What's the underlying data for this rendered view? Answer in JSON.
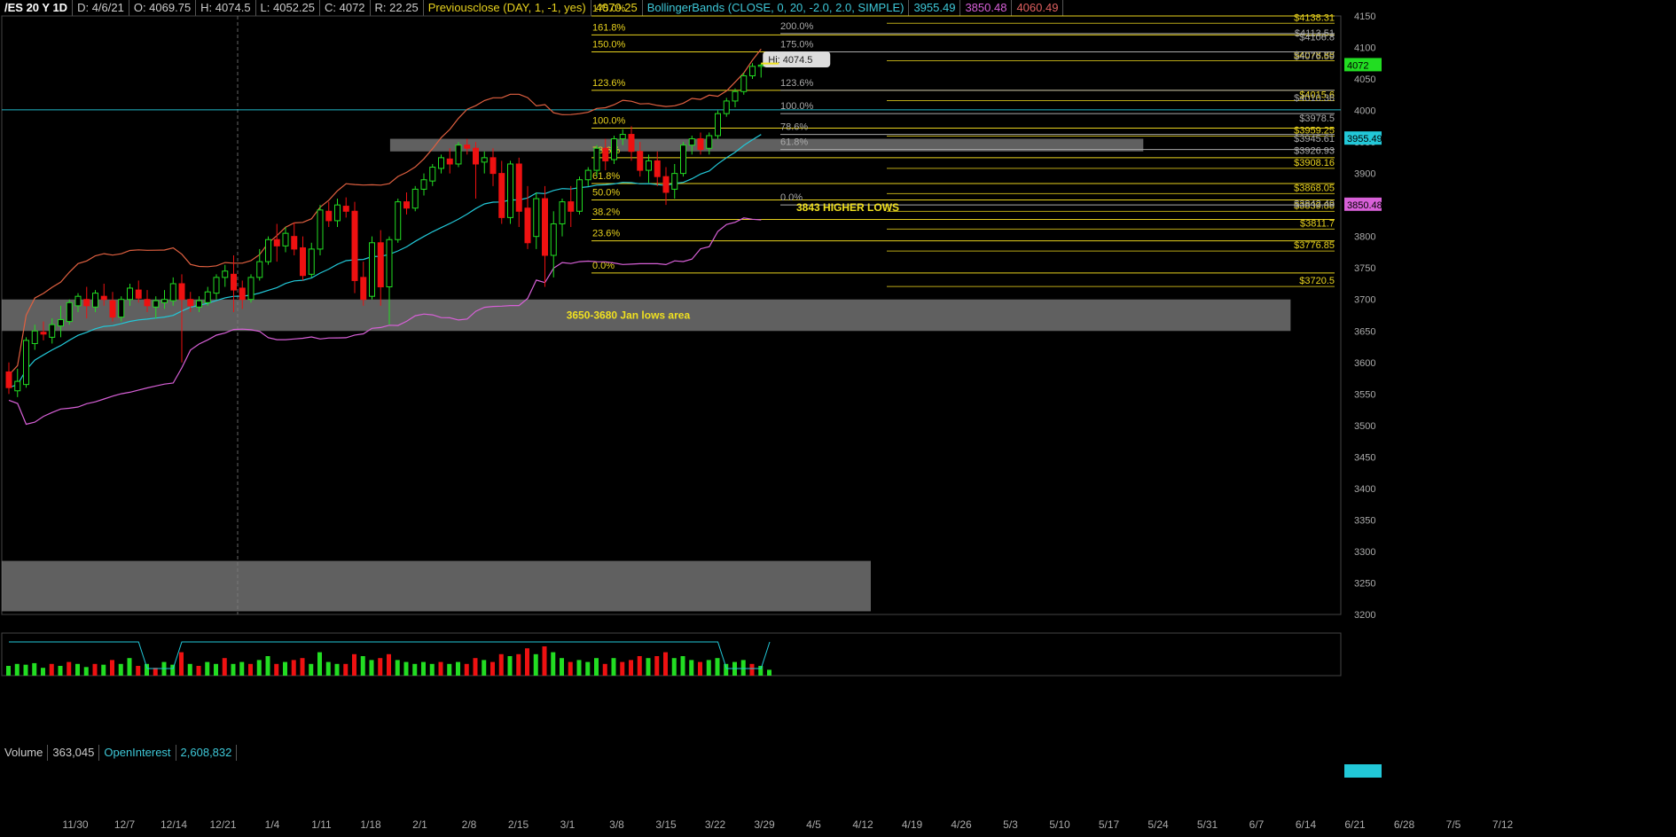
{
  "header": {
    "symbol": "/ES 20 Y 1D",
    "date": "D: 4/6/21",
    "open": "O: 4069.75",
    "high": "H: 4074.5",
    "low": "L: 4052.25",
    "close": "C: 4072",
    "range": "R: 22.25",
    "prevclose_label": "Previousclose (DAY, 1, -1, yes)",
    "prevclose_value": "4070.25",
    "bb_label": "BollingerBands (CLOSE, 0, 20, -2.0, 2.0, SIMPLE)",
    "bb_mid": "3955.49",
    "bb_lower": "3850.48",
    "bb_upper": "4060.49"
  },
  "volume_header": {
    "volume_label": "Volume",
    "volume_value": "363,045",
    "oi_label": "OpenInterest",
    "oi_value": "2,608,832"
  },
  "colors": {
    "up": "#22dd22",
    "down": "#ee1111",
    "fib": "#e8d21e",
    "bb_mid": "#22c8d8",
    "bb_upper": "#e06040",
    "bb_lower": "#d860d8",
    "zone": "#808080",
    "gray_line": "#aaaaaa"
  },
  "chart_data": {
    "type": "candlestick",
    "ylim": [
      3200,
      4150
    ],
    "y_ticks": [
      3200,
      3250,
      3300,
      3350,
      3400,
      3450,
      3500,
      3550,
      3600,
      3650,
      3700,
      3750,
      3800,
      3850,
      3900,
      3950,
      4000,
      4050,
      4100,
      4150
    ],
    "x_tick_labels": [
      "11/30",
      "12/7",
      "12/14",
      "12/21",
      "1/4",
      "1/11",
      "1/18",
      "2/1",
      "2/8",
      "2/15",
      "3/1",
      "3/8",
      "3/15",
      "3/22",
      "3/29",
      "4/5",
      "4/12",
      "4/19",
      "4/26",
      "5/3",
      "5/10",
      "5/17",
      "5/24",
      "5/31",
      "6/7",
      "6/14",
      "6/21",
      "6/28",
      "7/5",
      "7/12"
    ],
    "last_price": "4072",
    "bb_mid_tag": "3955.49",
    "bb_lower_tag": "3850.48",
    "hi_label": "Hi: 4074.5",
    "candles": [
      [
        3585,
        3600,
        3560,
        3550
      ],
      [
        3555,
        3590,
        3570,
        3545
      ],
      [
        3565,
        3640,
        3635,
        3560
      ],
      [
        3630,
        3660,
        3650,
        3620
      ],
      [
        3648,
        3665,
        3645,
        3635
      ],
      [
        3640,
        3670,
        3660,
        3630
      ],
      [
        3658,
        3690,
        3668,
        3640
      ],
      [
        3665,
        3700,
        3695,
        3660
      ],
      [
        3690,
        3710,
        3705,
        3680
      ],
      [
        3700,
        3720,
        3690,
        3670
      ],
      [
        3688,
        3715,
        3710,
        3680
      ],
      [
        3705,
        3725,
        3700,
        3690
      ],
      [
        3698,
        3712,
        3672,
        3665
      ],
      [
        3672,
        3705,
        3700,
        3665
      ],
      [
        3700,
        3725,
        3718,
        3690
      ],
      [
        3715,
        3730,
        3702,
        3695
      ],
      [
        3700,
        3715,
        3690,
        3680
      ],
      [
        3688,
        3705,
        3698,
        3670
      ],
      [
        3695,
        3715,
        3700,
        3685
      ],
      [
        3698,
        3735,
        3725,
        3690
      ],
      [
        3725,
        3740,
        3700,
        3600
      ],
      [
        3700,
        3712,
        3690,
        3680
      ],
      [
        3688,
        3705,
        3698,
        3680
      ],
      [
        3695,
        3720,
        3712,
        3690
      ],
      [
        3710,
        3740,
        3735,
        3700
      ],
      [
        3735,
        3755,
        3745,
        3720
      ],
      [
        3740,
        3770,
        3715,
        3680
      ],
      [
        3718,
        3730,
        3700,
        3685
      ],
      [
        3700,
        3740,
        3735,
        3695
      ],
      [
        3735,
        3780,
        3760,
        3730
      ],
      [
        3760,
        3800,
        3795,
        3755
      ],
      [
        3795,
        3820,
        3785,
        3760
      ],
      [
        3785,
        3815,
        3805,
        3775
      ],
      [
        3800,
        3822,
        3780,
        3770
      ],
      [
        3782,
        3800,
        3738,
        3730
      ],
      [
        3740,
        3790,
        3780,
        3735
      ],
      [
        3780,
        3850,
        3842,
        3770
      ],
      [
        3840,
        3855,
        3825,
        3815
      ],
      [
        3825,
        3860,
        3850,
        3815
      ],
      [
        3848,
        3862,
        3840,
        3830
      ],
      [
        3840,
        3855,
        3730,
        3710
      ],
      [
        3735,
        3760,
        3700,
        3690
      ],
      [
        3705,
        3800,
        3790,
        3700
      ],
      [
        3790,
        3810,
        3720,
        3690
      ],
      [
        3720,
        3800,
        3795,
        3660
      ],
      [
        3795,
        3860,
        3855,
        3790
      ],
      [
        3855,
        3870,
        3845,
        3835
      ],
      [
        3845,
        3880,
        3875,
        3840
      ],
      [
        3875,
        3900,
        3890,
        3865
      ],
      [
        3888,
        3915,
        3910,
        3880
      ],
      [
        3908,
        3930,
        3925,
        3900
      ],
      [
        3923,
        3940,
        3915,
        3900
      ],
      [
        3915,
        3950,
        3945,
        3910
      ],
      [
        3945,
        3955,
        3940,
        3930
      ],
      [
        3940,
        3950,
        3915,
        3860
      ],
      [
        3918,
        3935,
        3925,
        3900
      ],
      [
        3925,
        3940,
        3900,
        3880
      ],
      [
        3900,
        3920,
        3830,
        3820
      ],
      [
        3830,
        3920,
        3915,
        3820
      ],
      [
        3915,
        3925,
        3840,
        3815
      ],
      [
        3845,
        3880,
        3790,
        3780
      ],
      [
        3800,
        3870,
        3860,
        3780
      ],
      [
        3860,
        3880,
        3770,
        3720
      ],
      [
        3770,
        3840,
        3820,
        3735
      ],
      [
        3820,
        3860,
        3855,
        3800
      ],
      [
        3855,
        3880,
        3840,
        3815
      ],
      [
        3840,
        3895,
        3890,
        3835
      ],
      [
        3890,
        3910,
        3905,
        3880
      ],
      [
        3905,
        3945,
        3940,
        3895
      ],
      [
        3940,
        3955,
        3920,
        3905
      ],
      [
        3922,
        3960,
        3955,
        3915
      ],
      [
        3955,
        3970,
        3962,
        3945
      ],
      [
        3962,
        3975,
        3935,
        3920
      ],
      [
        3935,
        3950,
        3905,
        3895
      ],
      [
        3905,
        3930,
        3920,
        3885
      ],
      [
        3920,
        3935,
        3895,
        3880
      ],
      [
        3895,
        3910,
        3870,
        3850
      ],
      [
        3875,
        3915,
        3900,
        3860
      ],
      [
        3900,
        3950,
        3945,
        3895
      ],
      [
        3945,
        3960,
        3955,
        3930
      ],
      [
        3955,
        3965,
        3938,
        3930
      ],
      [
        3940,
        3965,
        3960,
        3930
      ],
      [
        3960,
        4000,
        3995,
        3955
      ],
      [
        3995,
        4020,
        4015,
        3990
      ],
      [
        4015,
        4035,
        4030,
        4005
      ],
      [
        4030,
        4060,
        4055,
        4025
      ],
      [
        4055,
        4075,
        4070,
        4050
      ],
      [
        4070,
        4074.5,
        4072,
        4052.25
      ]
    ],
    "volume": [
      [
        0.25,
        1
      ],
      [
        0.3,
        1
      ],
      [
        0.28,
        1
      ],
      [
        0.32,
        1
      ],
      [
        0.2,
        1
      ],
      [
        0.3,
        0
      ],
      [
        0.25,
        1
      ],
      [
        0.35,
        0
      ],
      [
        0.3,
        1
      ],
      [
        0.22,
        1
      ],
      [
        0.3,
        0
      ],
      [
        0.28,
        1
      ],
      [
        0.4,
        0
      ],
      [
        0.3,
        1
      ],
      [
        0.45,
        1
      ],
      [
        0.25,
        0
      ],
      [
        0.3,
        1
      ],
      [
        0.2,
        0
      ],
      [
        0.35,
        1
      ],
      [
        0.28,
        1
      ],
      [
        0.6,
        0
      ],
      [
        0.3,
        1
      ],
      [
        0.25,
        0
      ],
      [
        0.35,
        1
      ],
      [
        0.3,
        1
      ],
      [
        0.45,
        0
      ],
      [
        0.3,
        1
      ],
      [
        0.35,
        1
      ],
      [
        0.3,
        0
      ],
      [
        0.4,
        1
      ],
      [
        0.5,
        1
      ],
      [
        0.3,
        0
      ],
      [
        0.35,
        1
      ],
      [
        0.4,
        0
      ],
      [
        0.45,
        0
      ],
      [
        0.3,
        1
      ],
      [
        0.6,
        1
      ],
      [
        0.35,
        1
      ],
      [
        0.3,
        1
      ],
      [
        0.3,
        0
      ],
      [
        0.55,
        0
      ],
      [
        0.5,
        1
      ],
      [
        0.4,
        1
      ],
      [
        0.45,
        0
      ],
      [
        0.55,
        0
      ],
      [
        0.4,
        1
      ],
      [
        0.35,
        1
      ],
      [
        0.3,
        1
      ],
      [
        0.35,
        1
      ],
      [
        0.3,
        1
      ],
      [
        0.35,
        0
      ],
      [
        0.3,
        1
      ],
      [
        0.35,
        1
      ],
      [
        0.3,
        0
      ],
      [
        0.45,
        0
      ],
      [
        0.4,
        1
      ],
      [
        0.35,
        0
      ],
      [
        0.55,
        0
      ],
      [
        0.5,
        1
      ],
      [
        0.55,
        0
      ],
      [
        0.7,
        0
      ],
      [
        0.55,
        1
      ],
      [
        0.75,
        0
      ],
      [
        0.6,
        1
      ],
      [
        0.45,
        1
      ],
      [
        0.35,
        0
      ],
      [
        0.4,
        1
      ],
      [
        0.35,
        1
      ],
      [
        0.45,
        1
      ],
      [
        0.3,
        0
      ],
      [
        0.45,
        1
      ],
      [
        0.35,
        0
      ],
      [
        0.4,
        0
      ],
      [
        0.5,
        0
      ],
      [
        0.45,
        1
      ],
      [
        0.5,
        0
      ],
      [
        0.6,
        0
      ],
      [
        0.45,
        1
      ],
      [
        0.5,
        1
      ],
      [
        0.4,
        1
      ],
      [
        0.35,
        0
      ],
      [
        0.4,
        1
      ],
      [
        0.45,
        1
      ],
      [
        0.3,
        1
      ],
      [
        0.35,
        1
      ],
      [
        0.4,
        1
      ],
      [
        0.3,
        0
      ],
      [
        0.25,
        1
      ],
      [
        0.15,
        1
      ]
    ],
    "zones": [
      {
        "top": 3955,
        "bottom": 3935,
        "x_from": 0.29,
        "x_to": 0.775
      },
      {
        "top": 3700,
        "bottom": 3650,
        "x_from": 0.0,
        "x_to": 0.875,
        "label": "3650-3680 Jan lows area"
      },
      {
        "top": 3285,
        "bottom": 3205,
        "x_from": 0.0,
        "x_to": 0.59
      }
    ],
    "fib_left": {
      "levels": [
        {
          "pct": "175.0%",
          "price": 4150
        },
        {
          "pct": "161.8%",
          "price": 4120
        },
        {
          "pct": "150.0%",
          "price": 4093
        },
        {
          "pct": "123.6%",
          "price": 4032
        },
        {
          "pct": "100.0%",
          "price": 3972
        },
        {
          "pct": "78.6%",
          "price": 3925
        },
        {
          "pct": "61.8%",
          "price": 3884
        },
        {
          "pct": "50.0%",
          "price": 3858
        },
        {
          "pct": "38.2%",
          "price": 3827
        },
        {
          "pct": "23.6%",
          "price": 3793
        },
        {
          "pct": "0.0%",
          "price": 3742
        }
      ],
      "right_labels": [
        {
          "text": "$4138.31",
          "price": 4138.31
        },
        {
          "text": "$4078.88",
          "price": 4078.88
        },
        {
          "text": "$4015.6",
          "price": 4015.6
        },
        {
          "text": "$3959.25",
          "price": 3959.25
        },
        {
          "text": "$3908.16",
          "price": 3908.16
        },
        {
          "text": "$3868.05",
          "price": 3868.05
        },
        {
          "text": "$3839.88",
          "price": 3839.88
        },
        {
          "text": "$3811.7",
          "price": 3811.7
        },
        {
          "text": "$3776.85",
          "price": 3776.85
        },
        {
          "text": "$3720.5",
          "price": 3720.5
        }
      ]
    },
    "fib_right": {
      "levels": [
        {
          "pct": "200.0%",
          "price": 4122
        },
        {
          "pct": "175.0%",
          "price": 4093
        },
        {
          "pct": "123.6%",
          "price": 4032
        },
        {
          "pct": "100.0%",
          "price": 3995
        },
        {
          "pct": "78.6%",
          "price": 3962
        },
        {
          "pct": "61.8%",
          "price": 3938
        },
        {
          "pct": "0.0%",
          "price": 3850
        }
      ],
      "right_labels": [
        {
          "text": "$4113.51",
          "price": 4113.51
        },
        {
          "text": "$4106.8",
          "price": 4106.8
        },
        {
          "text": "$4076.59",
          "price": 4076.59
        },
        {
          "text": "$4010.36",
          "price": 4010.36
        },
        {
          "text": "$3978.5",
          "price": 3978.5
        },
        {
          "text": "$3945.61",
          "price": 3945.61
        },
        {
          "text": "$3926.93",
          "price": 3926.93
        },
        {
          "text": "$3842.49",
          "price": 3842.49
        }
      ]
    },
    "annotations": [
      {
        "text": "3843 HIGHER LOWS",
        "price": 3843
      }
    ]
  }
}
